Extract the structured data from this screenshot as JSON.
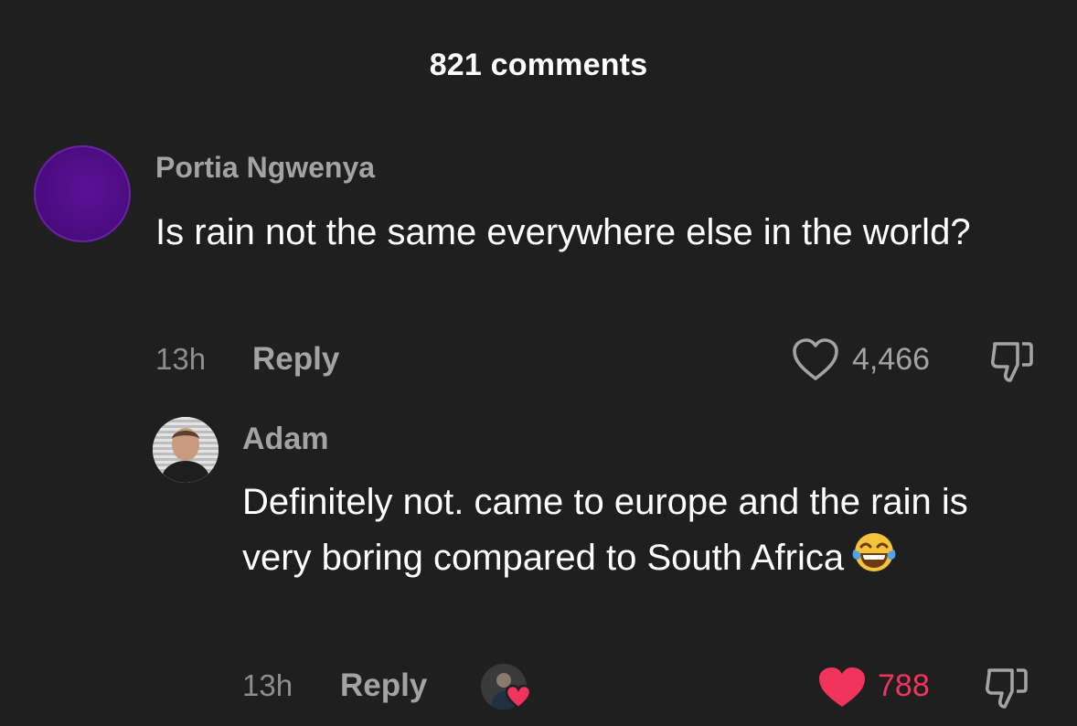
{
  "header": {
    "comment_count_label": "821 comments"
  },
  "comments": [
    {
      "author": "Portia Ngwenya",
      "text": "Is rain not the same everywhere else in the world?",
      "time": "13h",
      "reply_label": "Reply",
      "likes": "4,466",
      "liked": false,
      "avatar_color": "#4a0c80",
      "like_icon": "heart-outline-icon",
      "dislike_icon": "thumbs-down-icon"
    }
  ],
  "replies": [
    {
      "author": "Adam",
      "text": "Definitely not. came to europe and the rain is very boring compared to South Africa",
      "emoji": "face-with-tears-of-joy",
      "time": "13h",
      "reply_label": "Reply",
      "likes": "788",
      "liked": true,
      "creator_liked": true,
      "like_color": "#f0345c",
      "like_icon": "heart-filled-icon",
      "dislike_icon": "thumbs-down-icon"
    }
  ],
  "colors": {
    "background": "#1f1f1f",
    "secondary_text": "#a3a3a3",
    "like_active": "#f0345c"
  }
}
